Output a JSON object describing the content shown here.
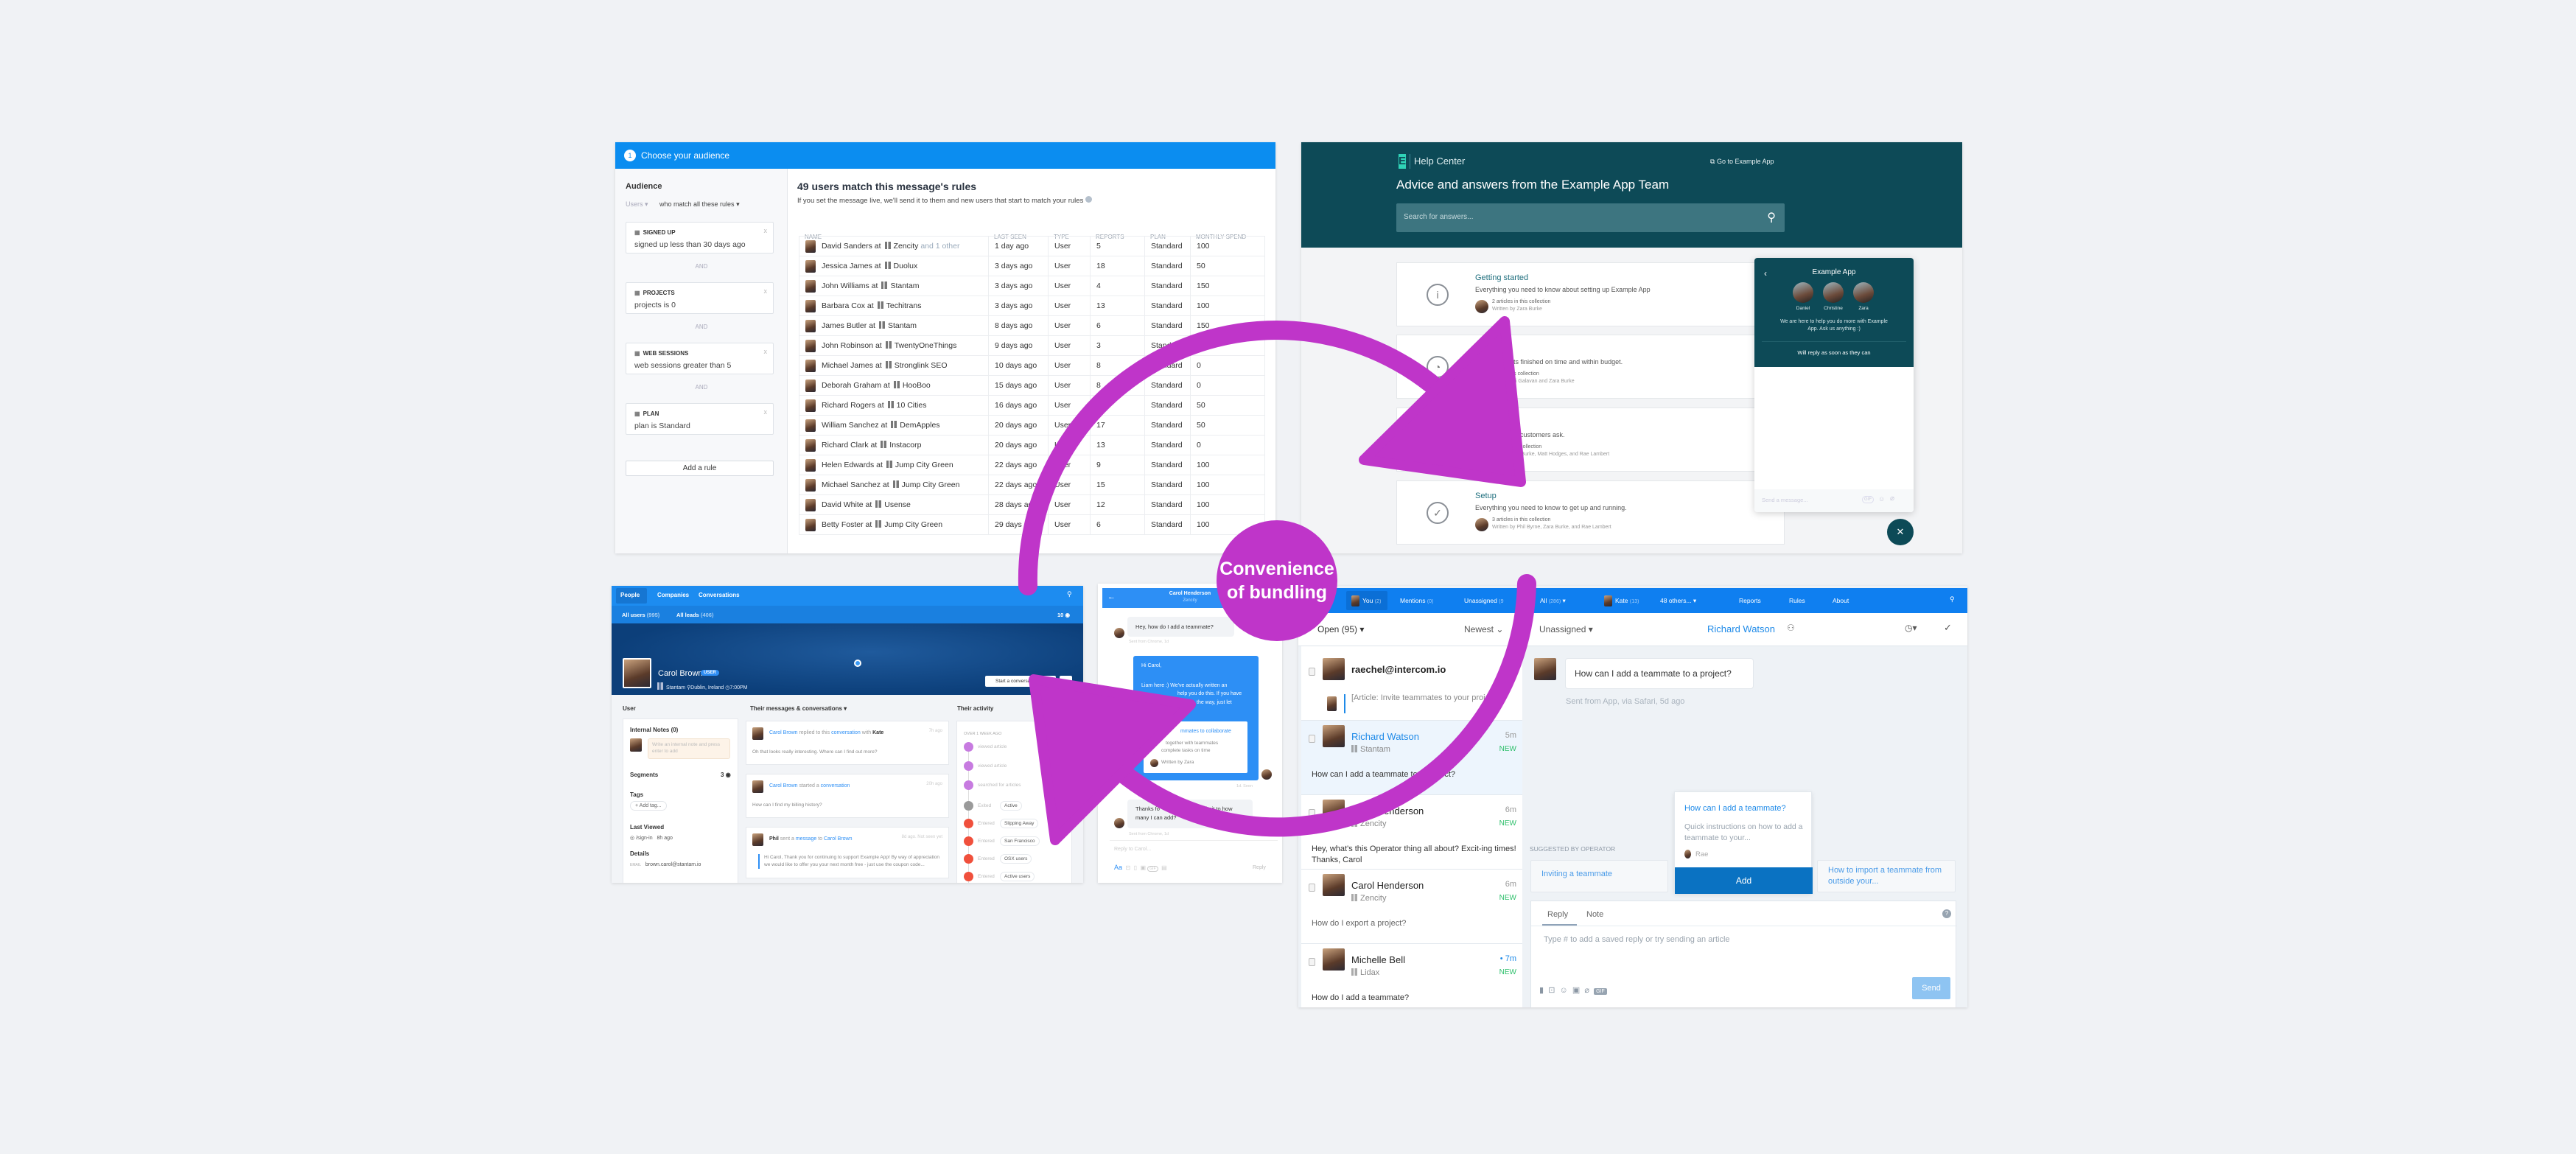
{
  "overlay": {
    "badge_line1": "Convenience",
    "badge_line2": "of bundling",
    "accent": "#bf35c9"
  },
  "audience": {
    "step": "1",
    "header": "Choose your audience",
    "sidebar_title": "Audience",
    "users_select": "Users",
    "match_select": "who match all these rules",
    "and_label": "AND",
    "rules": [
      {
        "title": "SIGNED UP",
        "desc": "signed up less than 30 days ago",
        "icon": "calendar-icon"
      },
      {
        "title": "PROJECTS",
        "desc": "projects is 0",
        "icon": "sliders-icon"
      },
      {
        "title": "WEB SESSIONS",
        "desc": "web sessions greater than 5",
        "icon": "browser-icon"
      },
      {
        "title": "PLAN",
        "desc": "plan is Standard",
        "icon": "briefcase-icon"
      }
    ],
    "add_rule": "Add a rule",
    "match_title": "49 users match this message's rules",
    "match_subtitle": "If you set the message live, we'll send it to them and new users that start to match your rules",
    "columns": [
      "NAME",
      "LAST SEEN",
      "TYPE",
      "REPORTS",
      "PLAN",
      "MONTHLY SPEND"
    ],
    "rows": [
      {
        "name": "David Sanders at",
        "company": "Zencity",
        "extra": "and 1 other",
        "last_seen": "1 day ago",
        "type": "User",
        "reports": "5",
        "plan": "Standard",
        "spend": "100"
      },
      {
        "name": "Jessica James at",
        "company": "Duolux",
        "extra": "",
        "last_seen": "3 days ago",
        "type": "User",
        "reports": "18",
        "plan": "Standard",
        "spend": "50"
      },
      {
        "name": "John Williams at",
        "company": "Stantam",
        "extra": "",
        "last_seen": "3 days ago",
        "type": "User",
        "reports": "4",
        "plan": "Standard",
        "spend": "150"
      },
      {
        "name": "Barbara Cox at",
        "company": "Techitrans",
        "extra": "",
        "last_seen": "3 days ago",
        "type": "User",
        "reports": "13",
        "plan": "Standard",
        "spend": "100"
      },
      {
        "name": "James Butler at",
        "company": "Stantam",
        "extra": "",
        "last_seen": "8 days ago",
        "type": "User",
        "reports": "6",
        "plan": "Standard",
        "spend": "150"
      },
      {
        "name": "John Robinson at",
        "company": "TwentyOneThings",
        "extra": "",
        "last_seen": "9 days ago",
        "type": "User",
        "reports": "3",
        "plan": "Standard",
        "spend": ""
      },
      {
        "name": "Michael James at",
        "company": "Stronglink SEO",
        "extra": "",
        "last_seen": "10 days ago",
        "type": "User",
        "reports": "8",
        "plan": "Standard",
        "spend": "0"
      },
      {
        "name": "Deborah Graham at",
        "company": "HooBoo",
        "extra": "",
        "last_seen": "15 days ago",
        "type": "User",
        "reports": "8",
        "plan": "Standard",
        "spend": "0"
      },
      {
        "name": "Richard Rogers at",
        "company": "10 Cities",
        "extra": "",
        "last_seen": "16 days ago",
        "type": "User",
        "reports": "",
        "plan": "Standard",
        "spend": "50"
      },
      {
        "name": "William Sanchez at",
        "company": "DemApples",
        "extra": "",
        "last_seen": "20 days ago",
        "type": "User",
        "reports": "17",
        "plan": "Standard",
        "spend": "50"
      },
      {
        "name": "Richard Clark at",
        "company": "Instacorp",
        "extra": "",
        "last_seen": "20 days ago",
        "type": "User",
        "reports": "13",
        "plan": "Standard",
        "spend": "0"
      },
      {
        "name": "Helen Edwards at",
        "company": "Jump City Green",
        "extra": "",
        "last_seen": "22 days ago",
        "type": "User",
        "reports": "9",
        "plan": "Standard",
        "spend": "100"
      },
      {
        "name": "Michael Sanchez at",
        "company": "Jump City Green",
        "extra": "",
        "last_seen": "22 days ago",
        "type": "User",
        "reports": "15",
        "plan": "Standard",
        "spend": "100"
      },
      {
        "name": "David White at",
        "company": "Usense",
        "extra": "",
        "last_seen": "28 days ago",
        "type": "User",
        "reports": "12",
        "plan": "Standard",
        "spend": "100"
      },
      {
        "name": "Betty Foster at",
        "company": "Jump City Green",
        "extra": "",
        "last_seen": "29 days ago",
        "type": "User",
        "reports": "6",
        "plan": "Standard",
        "spend": "100"
      }
    ]
  },
  "help_center": {
    "logo_letter": "E",
    "brand": "Help Center",
    "go_to_app": "Go to Example App",
    "headline": "Advice and answers from the Example App Team",
    "search_placeholder": "Search for answers...",
    "collections": [
      {
        "title": "Getting started",
        "desc": "Everything you need to know about setting up Example App",
        "count": "2 articles in this collection",
        "authors": "Written by Zara Burke",
        "icon": "info-icon",
        "glyph": "i"
      },
      {
        "title": "es",
        "desc": "g your projects finished on time and within budget.",
        "count": "cles in this collection",
        "authors": "n by Ruairi Galavan and Zara Burke",
        "icon": "gauge-icon",
        "glyph": "◔"
      },
      {
        "title": "",
        "desc": "mon questions customers ask.",
        "count": "ticles in this collection",
        "authors": "tten by Zara Burke, Matt Hodges, and Rae Lambert",
        "icon": "question-icon",
        "glyph": "?"
      },
      {
        "title": "Setup",
        "desc": "Everything you need to know to get up and running.",
        "count": "3 articles in this collection",
        "authors": "Written by Phil Byrne, Zara Burke, and Rae Lambert",
        "icon": "check-circle-icon",
        "glyph": "✓"
      }
    ],
    "widget": {
      "title": "Example App",
      "team": [
        "Daniel",
        "Christine",
        "Zara"
      ],
      "intro": "We are here to help you do more with Example App. Ask us anything :)",
      "reply_time": "Will reply as soon as they can",
      "input_placeholder": "Send a message...",
      "gif": "GIF"
    },
    "colors": {
      "header": "#0d4a57"
    }
  },
  "profile": {
    "nav": [
      "People",
      "Companies",
      "Conversations"
    ],
    "all_users": "All users",
    "all_users_count": "(995)",
    "all_leads": "All leads",
    "all_leads_count": "(406)",
    "visitors": "10",
    "name": "Carol Brown",
    "badge": "USER",
    "company": "Stantam",
    "location": "Dublin, Ireland",
    "local_time": "7:00PM",
    "start_conversation": "Start a conversation",
    "more": "···",
    "col_user": "User",
    "col_messages": "Their messages & conversations",
    "col_activity": "Their activity",
    "internal_notes": "Internal Notes (0)",
    "note_placeholder": "Write an internal note and press enter to add",
    "segments": "Segments",
    "segments_count": "3",
    "tags": "Tags",
    "add_tag": "+ Add tag...",
    "last_viewed": "Last Viewed",
    "last_viewed_page": "/sign-in",
    "last_viewed_time": "8h ago",
    "details": "Details",
    "email_label": "EMAIL",
    "email": "brown.carol@stantam.io",
    "messages": [
      {
        "actor": "Carol Brown",
        "verb": "replied to this",
        "object": "conversation",
        "tail": "with",
        "who": "Kate",
        "time": "7h ago",
        "body": "Oh that looks really interesting. Where can I find out more?"
      },
      {
        "actor": "Carol Brown",
        "verb": "started a",
        "object": "conversation",
        "tail": "",
        "who": "",
        "time": "20h ago",
        "body": "How can I find my billing history?"
      },
      {
        "actor": "Phil",
        "verb": "sent a",
        "object": "message",
        "tail": "to",
        "who": "Carol Brown",
        "time": "8d ago. Not seen yet",
        "body": "Hi Carol, Thank you for continuing to support Example App! By way of appreciation we would like to offer you your next month free - just use the coupon code..."
      }
    ],
    "activity_heading": "OVER 1 WEEK AGO",
    "activity": [
      {
        "label": "viewed article",
        "tag": "",
        "color": "#c77be0"
      },
      {
        "label": "viewed article",
        "tag": "",
        "color": "#c77be0"
      },
      {
        "label": "searched for articles",
        "tag": "",
        "color": "#c77be0"
      },
      {
        "label": "Exited",
        "tag": "Active",
        "color": "#9a9a9a"
      },
      {
        "label": "Entered",
        "tag": "Slipping Away",
        "color": "#f0503c"
      },
      {
        "label": "Entered",
        "tag": "San Francisco",
        "color": "#f0503c"
      },
      {
        "label": "Entered",
        "tag": "OSX users",
        "color": "#f0503c"
      },
      {
        "label": "Entered",
        "tag": "Active users",
        "color": "#f0503c"
      }
    ]
  },
  "messenger": {
    "contact": "Carol Henderson",
    "company": "Zencity",
    "msg1": "Hey, how do I add a teammate?",
    "meta1": "Sent from Chrome, 1d",
    "reply_greeting": "Hi Carol,",
    "reply_line1": "Liam here :) We've actually written an",
    "reply_line2": "help you do this. If you have",
    "reply_line3": "the way, just let",
    "article_title": "mmates to collaborate",
    "article_line1": "together with teammates",
    "article_line2": "complete tasks on time",
    "article_author": "Written by Zara",
    "reply_meta": "1d. Seen",
    "msg3_a": "Thanks fo",
    "msg3_b": "limit to how",
    "msg3_c": "many I can add?",
    "meta3": "Sent from Chrome, 1d",
    "composer_placeholder": "Reply to Carol...",
    "font_btn": "Aa",
    "gif": "GIF",
    "send": "Reply"
  },
  "inbox": {
    "nav": [
      {
        "label": "You",
        "count": "(2)"
      },
      {
        "label": "Mentions",
        "count": "(0)"
      },
      {
        "label": "Unassigned",
        "count": "(9"
      },
      {
        "label": "All",
        "count": "(286)"
      },
      {
        "label": "Kate",
        "count": "(13)"
      },
      {
        "label": "48 others...",
        "count": ""
      },
      {
        "label": "Reports",
        "count": ""
      },
      {
        "label": "Rules",
        "count": ""
      },
      {
        "label": "About",
        "count": ""
      }
    ],
    "filter_open": "Open (95)",
    "sort": "Newest",
    "assignee": "Unassigned",
    "current_contact": "Richard Watson",
    "conversations": [
      {
        "name": "raechel@intercom.io",
        "company": "",
        "time": "",
        "new": "",
        "message": "[Article: Invite teammates to your project]"
      },
      {
        "name": "Richard Watson",
        "company": "Stantam",
        "time": "5m",
        "new": "NEW",
        "message": "How can I add a teammate to a project?"
      },
      {
        "name": "Carol Henderson",
        "company": "Zencity",
        "time": "6m",
        "new": "NEW",
        "message": "Hey, what's this Operator thing all about? Excit-ing times! Thanks, Carol"
      },
      {
        "name": "Carol Henderson",
        "company": "Zencity",
        "time": "6m",
        "new": "NEW",
        "message": "How do I export a project?"
      },
      {
        "name": "Michelle Bell",
        "company": "Lidax",
        "time": "• 7m",
        "new": "NEW",
        "message": "How do I add a teammate?"
      }
    ],
    "customer_message": "How can I add a teammate to a project?",
    "customer_meta": "Sent from App, via Safari, 5d ago",
    "suggested_label": "SUGGESTED BY OPERATOR",
    "suggestions": [
      "Inviting a teammate",
      "How to import a teammate from outside your..."
    ],
    "popup": {
      "title": "How can I add a teammate?",
      "desc": "Quick instructions on how to add a teammate to your...",
      "author": "Rae",
      "action": "Add"
    },
    "reply_tabs": [
      "Reply",
      "Note"
    ],
    "reply_placeholder": "Type # to add a saved reply or try sending an article",
    "gif": "GIF",
    "send": "Send"
  }
}
